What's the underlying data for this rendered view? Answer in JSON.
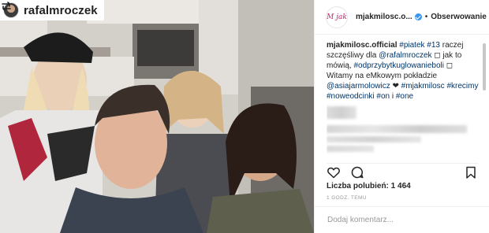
{
  "regram": {
    "username": "rafalmroczek",
    "icon": "repost-icon"
  },
  "post": {
    "account": "mjakmilosc.o...",
    "avatar_text": "M jak",
    "separator": "•",
    "follow_label": "Obserwowanie",
    "caption": {
      "user": "mjakmilosc.official",
      "segments": [
        {
          "text": "#piatek",
          "tag": true
        },
        {
          "text": " ",
          "tag": false
        },
        {
          "text": "#13",
          "tag": true
        },
        {
          "text": " raczej szczęśliwy dla ",
          "tag": false
        },
        {
          "text": "@rafalmroczek",
          "tag": true
        },
        {
          "text": " ◻ jak to mówią, ",
          "tag": false
        },
        {
          "text": "#odprzybytkuglowanieboli",
          "tag": true
        },
        {
          "text": " ◻ Witamy na eMkowym pokładzie ",
          "tag": false
        },
        {
          "text": "@asiajarmolowicz",
          "tag": true
        },
        {
          "text": " ❤ ",
          "tag": false
        },
        {
          "text": "#mjakmilosc",
          "tag": true
        },
        {
          "text": " ",
          "tag": false
        },
        {
          "text": "#krecimy",
          "tag": true
        },
        {
          "text": " ",
          "tag": false
        },
        {
          "text": "#nowe",
          "tag": true
        },
        {
          "text": "odcinki",
          "tag": true
        },
        {
          "text": " ",
          "tag": false
        },
        {
          "text": "#on",
          "tag": true
        },
        {
          "text": " i ",
          "tag": false
        },
        {
          "text": "#one",
          "tag": true
        }
      ]
    },
    "likes_label": "Liczba polubień: 1 464",
    "time_label": "1 GODZ. TEMU",
    "comment_placeholder": "Dodaj komentarz...",
    "icons": [
      "heart-icon",
      "comment-icon",
      "bookmark-icon"
    ]
  },
  "colors": {
    "link": "#003569",
    "verified": "#3897f0",
    "muted": "#999999"
  }
}
